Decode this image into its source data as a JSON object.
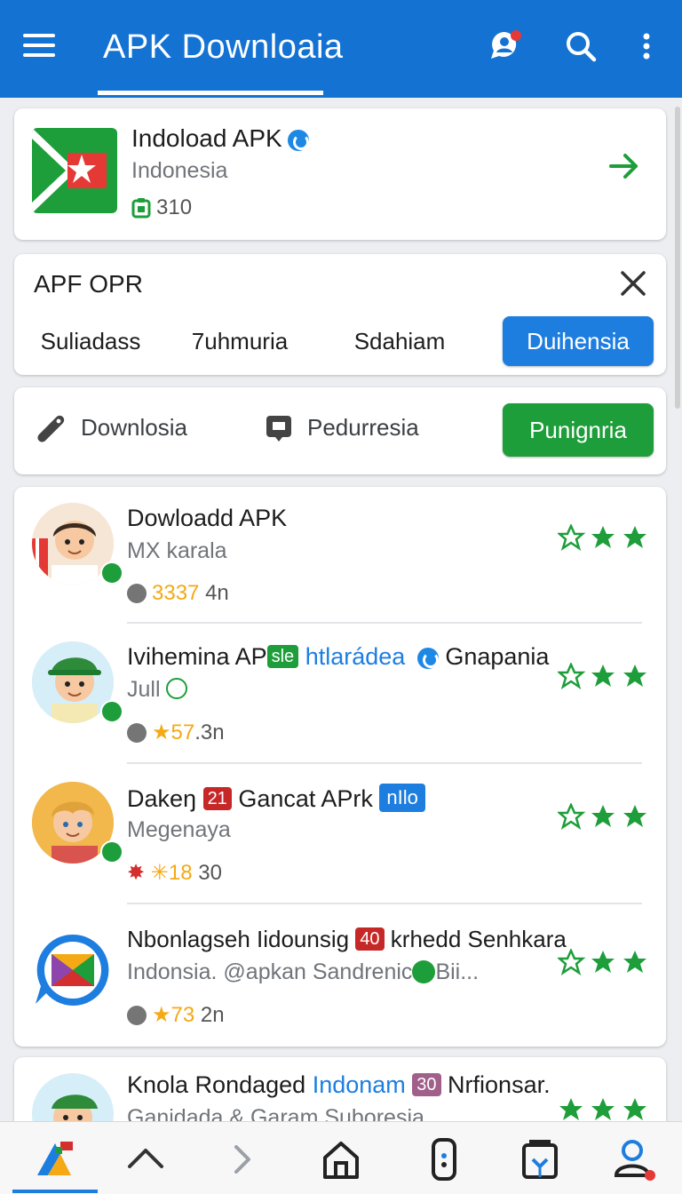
{
  "appbar": {
    "title": "APK Downloaia",
    "menu_icon": "hamburger-menu-icon",
    "actions": [
      "notification-icon",
      "search-icon",
      "overflow-menu-icon"
    ],
    "color": "#1473d2"
  },
  "featured": {
    "name": "Indoload APK",
    "subtitle": "Indonesia",
    "count": "310",
    "verified": true
  },
  "filter": {
    "title": "APF OPR",
    "chips": [
      "Suliadass",
      "7uhmuria",
      "Sdahiam",
      "Duihensia"
    ],
    "selected_index": 3
  },
  "categories": {
    "items": [
      "Downlosia",
      "Pedurresia"
    ],
    "button": "Punignria"
  },
  "list": [
    {
      "name": "Dowloadd APK",
      "sub": "MX karala",
      "meta_star": "3337",
      "meta_rest": "4n",
      "rating": 2
    },
    {
      "name_a": "Ivihemina AP",
      "tag_a": "sle",
      "name_b": "htlarádea",
      "name_c": "Gnapania",
      "sub": "Jull",
      "meta_star": "57",
      "meta_rest": ".3n",
      "rating": 2
    },
    {
      "name_a": "Dakeŋ",
      "tag_a": "21",
      "name_b": "Gancat APrk",
      "tag_b": "nIlo",
      "sub": "Megenaya",
      "meta_star": "18",
      "meta_rest": "30",
      "rating": 2
    },
    {
      "name_a": "Nbonlagseh Iidounsig",
      "tag_a": "40",
      "name_b": "krhedd Senhkara",
      "sub": "Indonsia. @apkan Sandrenic",
      "sub_tail": "Bii...",
      "meta_star": "73",
      "meta_rest": "2n",
      "rating": 2
    }
  ],
  "partial_item": {
    "name_a": "Knola Rondaged",
    "name_b": "Indonam",
    "tag": "30",
    "name_c": "Nrfionsar.",
    "sub": "Ganidada & Garam Suboresia"
  },
  "bottom_nav": [
    "play-store-icon",
    "chevron-up-icon",
    "chevron-right-icon",
    "home-icon",
    "phone-icon",
    "download-icon",
    "profile-icon"
  ]
}
